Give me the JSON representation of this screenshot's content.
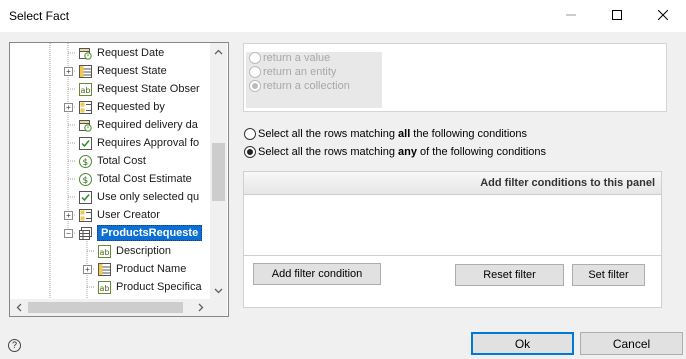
{
  "window": {
    "title": "Select Fact",
    "minimize_icon": "minimize-icon",
    "maximize_icon": "maximize-icon",
    "close_icon": "close-icon"
  },
  "tree": {
    "items": [
      {
        "label": "Request Date",
        "icon": "date-field-icon",
        "expandable": false
      },
      {
        "label": "Request State",
        "icon": "table-entity-icon",
        "expandable": true
      },
      {
        "label": "Request State Obser",
        "icon": "text-field-icon",
        "expandable": false
      },
      {
        "label": "Requested by",
        "icon": "entity-icon",
        "expandable": true
      },
      {
        "label": "Required delivery da",
        "icon": "date-field-icon",
        "expandable": false
      },
      {
        "label": "Requires Approval fo",
        "icon": "checkbox-field-icon",
        "expandable": false
      },
      {
        "label": "Total Cost",
        "icon": "currency-field-icon",
        "expandable": false
      },
      {
        "label": "Total Cost Estimate",
        "icon": "currency-field-icon",
        "expandable": false
      },
      {
        "label": "Use only selected qu",
        "icon": "checkbox-field-icon",
        "expandable": false
      },
      {
        "label": "User Creator",
        "icon": "entity-icon",
        "expandable": true
      },
      {
        "label": "ProductsRequeste",
        "icon": "collection-icon",
        "expandable": true,
        "expanded": true,
        "selected": true
      },
      {
        "label": "Description",
        "icon": "text-field-icon",
        "expandable": false,
        "child": true
      },
      {
        "label": "Product Name",
        "icon": "table-entity-icon",
        "expandable": true,
        "child": true
      },
      {
        "label": "Product Specifica",
        "icon": "text-field-icon",
        "expandable": false,
        "child": true
      }
    ]
  },
  "returns": {
    "options": [
      {
        "label": "return a value",
        "checked": false
      },
      {
        "label": "return an entity",
        "checked": false
      },
      {
        "label": "return a collection",
        "checked": true
      }
    ]
  },
  "match": {
    "all": {
      "prefix": "Select all the rows matching ",
      "keyword": "all",
      "suffix": " the following conditions",
      "checked": false
    },
    "any": {
      "prefix": "Select all the rows matching ",
      "keyword": "any",
      "suffix": " of the following conditions",
      "checked": true
    }
  },
  "filter_panel": {
    "header": "Add filter conditions to this panel",
    "add_button": "Add filter condition",
    "reset_button": "Reset  filter",
    "set_button": "Set  filter"
  },
  "footer": {
    "ok": "Ok",
    "cancel": "Cancel",
    "help_icon": "help-icon"
  },
  "colors": {
    "selection": "#0b6fd3",
    "accent_border": "#0078d7",
    "panel_bg": "#f0f0f0"
  }
}
